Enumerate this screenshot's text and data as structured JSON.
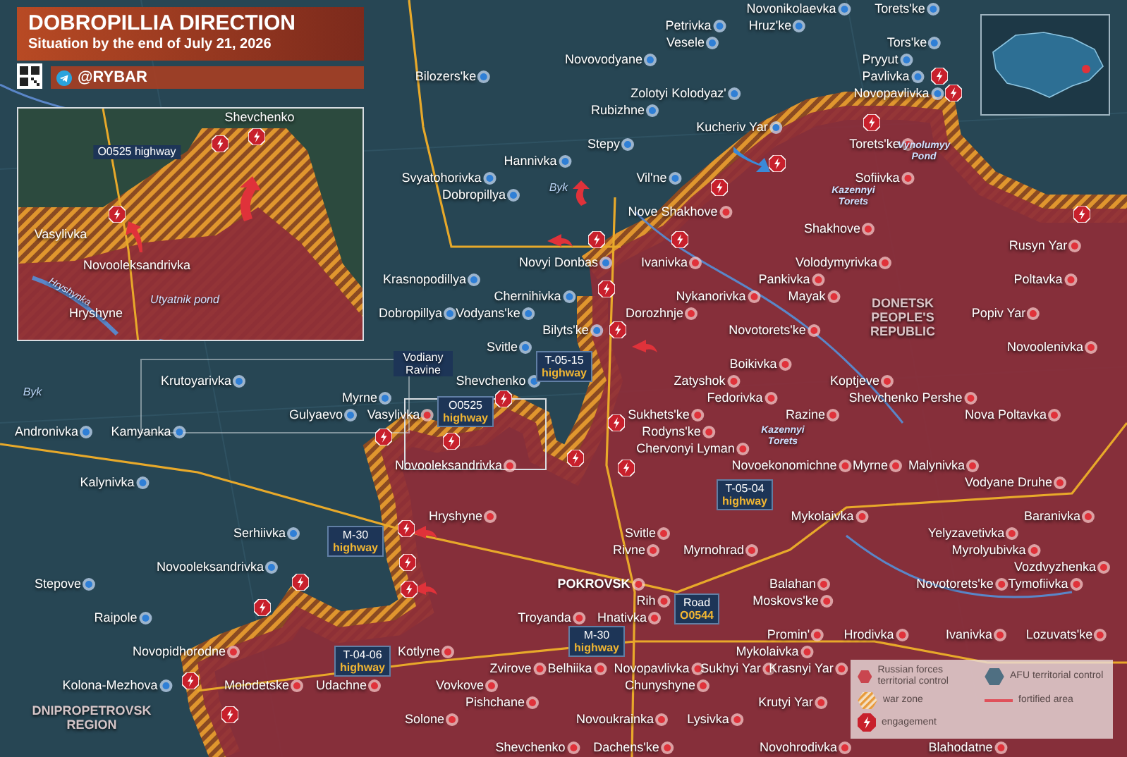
{
  "header": {
    "title": "DOBROPILLIA DIRECTION",
    "subtitle": "Situation by the end of July 21, 2026",
    "channel": "@RYBAR"
  },
  "inset": {
    "labels": [
      {
        "text": "Shevchenko",
        "kind": "town"
      },
      {
        "text": "O0525 highway",
        "kind": "road"
      },
      {
        "text": "Vasylivka",
        "kind": "town"
      },
      {
        "text": "Novooleksandrivka",
        "kind": "town"
      },
      {
        "text": "Hryshynka",
        "kind": "river"
      },
      {
        "text": "Utyatnik pond",
        "kind": "water"
      },
      {
        "text": "Hryshyne",
        "kind": "town"
      }
    ]
  },
  "towns": [
    {
      "name": "Novonikolaevka",
      "russian": false
    },
    {
      "name": "Torets'ke",
      "russian": false
    },
    {
      "name": "Petrivka",
      "russian": false
    },
    {
      "name": "Hruz'ke",
      "russian": false
    },
    {
      "name": "Vesele",
      "russian": false
    },
    {
      "name": "Tors'ke",
      "russian": false
    },
    {
      "name": "Novovodyane",
      "russian": false
    },
    {
      "name": "Pryyut",
      "russian": false
    },
    {
      "name": "Bilozers'ke",
      "russian": false
    },
    {
      "name": "Pavlivka",
      "russian": false
    },
    {
      "name": "Zolotyi Kolodyaz'",
      "russian": false
    },
    {
      "name": "Novopavlivka",
      "russian": false
    },
    {
      "name": "Rubizhne",
      "russian": false
    },
    {
      "name": "Kucheriv Yar",
      "russian": false
    },
    {
      "name": "Stepy",
      "russian": false
    },
    {
      "name": "Torets'ke",
      "russian": true
    },
    {
      "name": "Hannivka",
      "russian": false
    },
    {
      "name": "Svyatohorivka",
      "russian": false
    },
    {
      "name": "Vil'ne",
      "russian": false
    },
    {
      "name": "Sofiivka",
      "russian": true
    },
    {
      "name": "Dobropillya",
      "russian": false
    },
    {
      "name": "Nove Shakhove",
      "russian": true
    },
    {
      "name": "Shakhove",
      "russian": true
    },
    {
      "name": "Rusyn Yar",
      "russian": true
    },
    {
      "name": "Novyi Donbas",
      "russian": false
    },
    {
      "name": "Ivanivka",
      "russian": true
    },
    {
      "name": "Volodymyrivka",
      "russian": true
    },
    {
      "name": "Krasnopodillya",
      "russian": false
    },
    {
      "name": "Pankivka",
      "russian": true
    },
    {
      "name": "Poltavka",
      "russian": true
    },
    {
      "name": "Chernihivka",
      "russian": false
    },
    {
      "name": "Nykanorivka",
      "russian": true
    },
    {
      "name": "Mayak",
      "russian": true
    },
    {
      "name": "Dobropillya",
      "russian": false
    },
    {
      "name": "Vodyans'ke",
      "russian": false
    },
    {
      "name": "Dorozhnje",
      "russian": true
    },
    {
      "name": "Popiv Yar",
      "russian": true
    },
    {
      "name": "Bilyts'ke",
      "russian": false
    },
    {
      "name": "Novotorets'ke",
      "russian": true
    },
    {
      "name": "Svitle",
      "russian": false
    },
    {
      "name": "Novoolenivka",
      "russian": true
    },
    {
      "name": "Boikivka",
      "russian": true
    },
    {
      "name": "Krutoyarivka",
      "russian": false
    },
    {
      "name": "Shevchenko",
      "russian": false
    },
    {
      "name": "Zatyshok",
      "russian": true
    },
    {
      "name": "Koptjeve",
      "russian": true
    },
    {
      "name": "Myrne",
      "russian": false
    },
    {
      "name": "Fedorivka",
      "russian": true
    },
    {
      "name": "Shevchenko Pershe",
      "russian": true
    },
    {
      "name": "Gulyaevo",
      "russian": false
    },
    {
      "name": "Vasylivka",
      "russian": true
    },
    {
      "name": "Sukhets'ke",
      "russian": true
    },
    {
      "name": "Razine",
      "russian": true
    },
    {
      "name": "Nova Poltavka",
      "russian": true
    },
    {
      "name": "Andronivka",
      "russian": false
    },
    {
      "name": "Kamyanka",
      "russian": false
    },
    {
      "name": "Rodyns'ke",
      "russian": true
    },
    {
      "name": "Chervonyi Lyman",
      "russian": true
    },
    {
      "name": "Novooleksandrivka",
      "russian": true
    },
    {
      "name": "Novoekonomichne",
      "russian": true
    },
    {
      "name": "Myrne",
      "russian": true
    },
    {
      "name": "Malynivka",
      "russian": true
    },
    {
      "name": "Kalynivka",
      "russian": false
    },
    {
      "name": "Vodyane Druhe",
      "russian": true
    },
    {
      "name": "Hryshyne",
      "russian": true
    },
    {
      "name": "Mykolaivka",
      "russian": true
    },
    {
      "name": "Baranivka",
      "russian": true
    },
    {
      "name": "Serhiivka",
      "russian": false
    },
    {
      "name": "Svitle",
      "russian": true
    },
    {
      "name": "Yelyzavetivka",
      "russian": true
    },
    {
      "name": "Rivne",
      "russian": true
    },
    {
      "name": "Myrnohrad",
      "russian": true
    },
    {
      "name": "Myrolyubivka",
      "russian": true
    },
    {
      "name": "Novooleksandrivka",
      "russian": false
    },
    {
      "name": "Vozdvyzhenka",
      "russian": true
    },
    {
      "name": "Stepove",
      "russian": false
    },
    {
      "name": "POKROVSK",
      "russian": true
    },
    {
      "name": "Balahan",
      "russian": true
    },
    {
      "name": "Novotorets'ke",
      "russian": true
    },
    {
      "name": "Tymofiivka",
      "russian": true
    },
    {
      "name": "Rih",
      "russian": true
    },
    {
      "name": "Moskovs'ke",
      "russian": true
    },
    {
      "name": "Raipole",
      "russian": false
    },
    {
      "name": "Troyanda",
      "russian": true
    },
    {
      "name": "Hnativka",
      "russian": true
    },
    {
      "name": "Promin'",
      "russian": true
    },
    {
      "name": "Hrodivka",
      "russian": true
    },
    {
      "name": "Ivanivka",
      "russian": true
    },
    {
      "name": "Lozuvats'ke",
      "russian": true
    },
    {
      "name": "Novopidhorodne",
      "russian": true
    },
    {
      "name": "Kotlyne",
      "russian": true
    },
    {
      "name": "Mykolaivka",
      "russian": true
    },
    {
      "name": "Zvirove",
      "russian": true
    },
    {
      "name": "Belhiika",
      "russian": true
    },
    {
      "name": "Novopavlivka",
      "russian": true
    },
    {
      "name": "Sukhyi Yar",
      "russian": true
    },
    {
      "name": "Krasnyi Yar",
      "russian": true
    },
    {
      "name": "Kolona-Mezhova",
      "russian": false
    },
    {
      "name": "Molodetske",
      "russian": true
    },
    {
      "name": "Udachne",
      "russian": true
    },
    {
      "name": "Vovkove",
      "russian": true
    },
    {
      "name": "Chunyshyne",
      "russian": true
    },
    {
      "name": "Pishchane",
      "russian": true
    },
    {
      "name": "Krutyi Yar",
      "russian": true
    },
    {
      "name": "Solone",
      "russian": true
    },
    {
      "name": "Novoukrainka",
      "russian": true
    },
    {
      "name": "Lysivka",
      "russian": true
    },
    {
      "name": "Shevchenko",
      "russian": true
    },
    {
      "name": "Dachens'ke",
      "russian": true
    },
    {
      "name": "Novohrodivka",
      "russian": true
    },
    {
      "name": "Blahodatne",
      "russian": true
    }
  ],
  "map_labels": [
    {
      "text": "Vynolumyy Pond",
      "kind": "water"
    },
    {
      "text": "Byk",
      "kind": "river"
    },
    {
      "text": "Kazennyi Torets",
      "kind": "water"
    },
    {
      "text": "DONETSK PEOPLE'S REPUBLIC",
      "kind": "region"
    },
    {
      "text": "Vodiany Ravine",
      "kind": "ravine"
    },
    {
      "text": "Byk",
      "kind": "river"
    },
    {
      "text": "Kazennyi Torets",
      "kind": "water"
    },
    {
      "text": "DNIPROPETROVSK REGION",
      "kind": "region"
    }
  ],
  "roads": [
    {
      "code": "T-05-15",
      "label": "highway"
    },
    {
      "code": "O0525",
      "label": "highway"
    },
    {
      "code": "T-05-04",
      "label": "highway"
    },
    {
      "code": "M-30",
      "label": "highway"
    },
    {
      "code": "Road",
      "label": "O0544"
    },
    {
      "code": "M-30",
      "label": "highway"
    },
    {
      "code": "T-04-06",
      "label": "highway"
    }
  ],
  "legend": [
    {
      "kind": "russian",
      "label": "Russian forces territorial control"
    },
    {
      "kind": "afu",
      "label": "AFU territorial control"
    },
    {
      "kind": "war_zone",
      "label": "war zone"
    },
    {
      "kind": "fortified",
      "label": "fortified area"
    },
    {
      "kind": "engagement",
      "label": "engagement"
    }
  ]
}
